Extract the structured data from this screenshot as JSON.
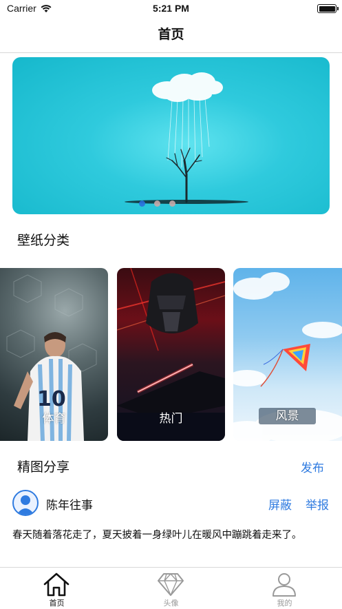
{
  "status_bar": {
    "carrier": "Carrier",
    "time": "5:21 PM"
  },
  "nav": {
    "title": "首页"
  },
  "banner": {
    "page_count": 3,
    "active_page": 1
  },
  "categories": {
    "title": "壁纸分类",
    "items": [
      {
        "label": "体育"
      },
      {
        "label": "热门"
      },
      {
        "label": "风景"
      }
    ]
  },
  "share": {
    "title": "精图分享",
    "publish_label": "发布",
    "post": {
      "username": "陈年往事",
      "block_label": "屏蔽",
      "report_label": "举报",
      "text": "春天随着落花走了，夏天披着一身绿叶儿在暖风中蹦跳着走来了。"
    }
  },
  "tab_bar": {
    "tabs": [
      {
        "label": "首页",
        "icon": "home-icon",
        "active": true
      },
      {
        "label": "头像",
        "icon": "diamond-icon",
        "active": false
      },
      {
        "label": "我的",
        "icon": "user-icon",
        "active": false
      }
    ]
  },
  "colors": {
    "accent": "#2f7be0",
    "tab_inactive": "#999999"
  }
}
